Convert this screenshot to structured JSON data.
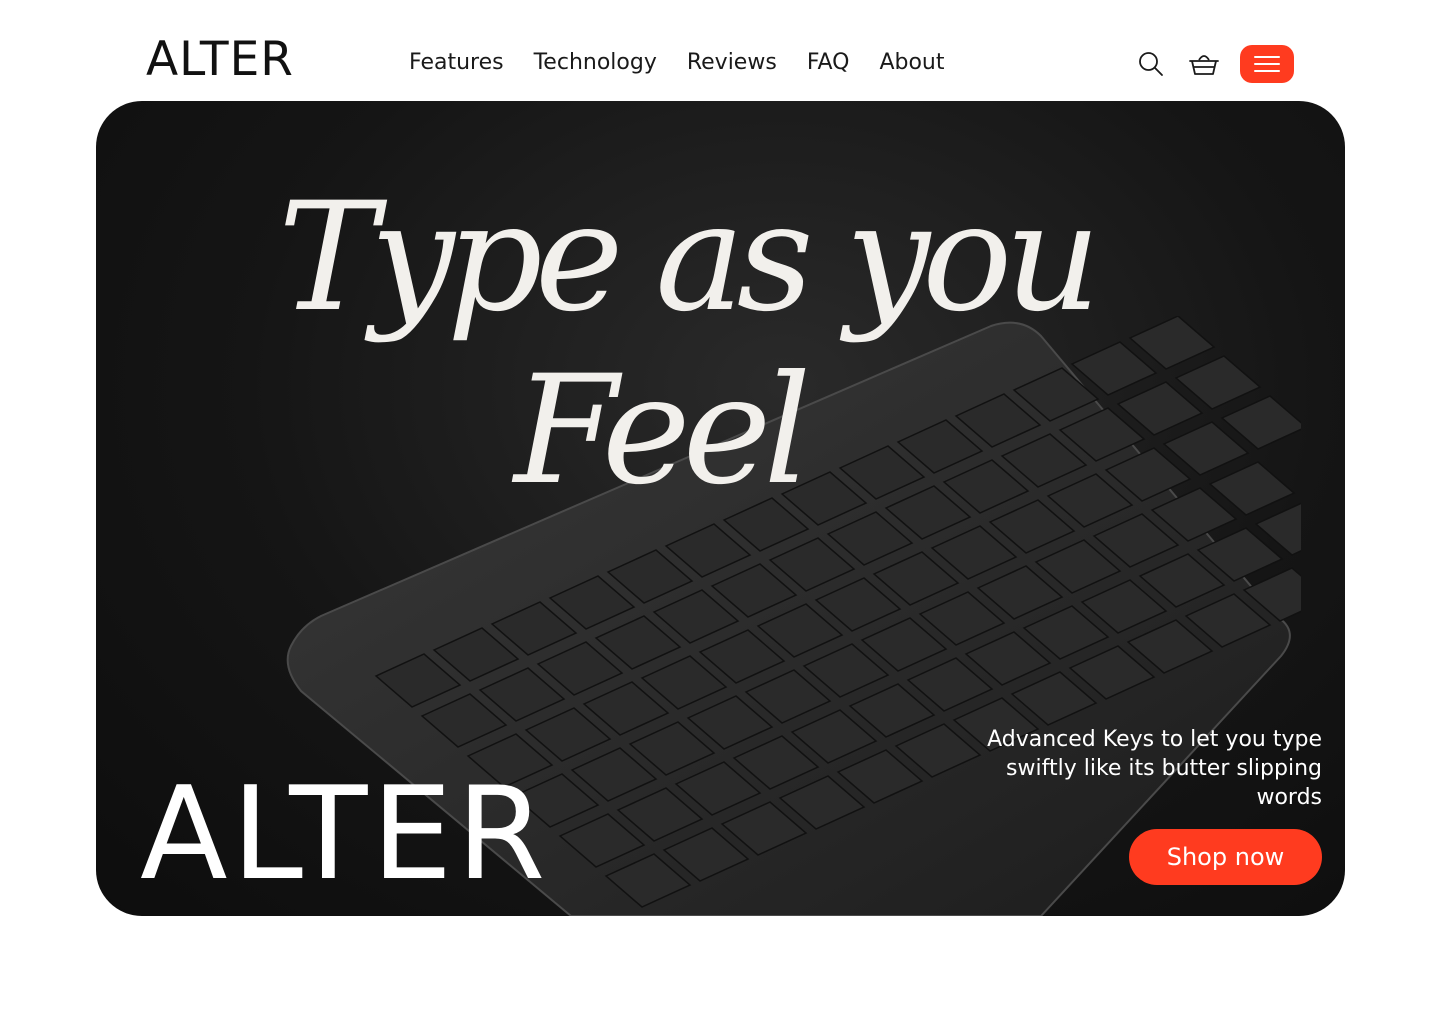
{
  "brand": {
    "name": "ALTER"
  },
  "nav": {
    "items": [
      {
        "label": "Features"
      },
      {
        "label": "Technology"
      },
      {
        "label": "Reviews"
      },
      {
        "label": "FAQ"
      },
      {
        "label": "About"
      }
    ]
  },
  "header_icons": {
    "search": "search-icon",
    "cart": "basket-icon",
    "menu": "hamburger-icon"
  },
  "colors": {
    "accent": "#ff3b1f",
    "hero_bg": "#151515",
    "text_light": "#f2f0ec"
  },
  "hero": {
    "headline_line1": "Type as you",
    "headline_line2": "Feel",
    "logo": "ALTER",
    "tagline": "Advanced Keys to let you type swiftly like its butter slipping words",
    "cta": "Shop now"
  }
}
